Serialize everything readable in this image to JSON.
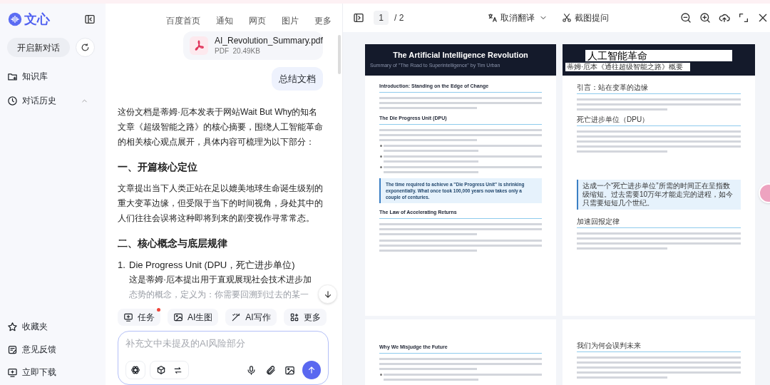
{
  "sidebar": {
    "logo": "文心",
    "new_chat": "开启新对话",
    "nav": [
      {
        "label": "知识库"
      },
      {
        "label": "对话历史",
        "expanded": true
      }
    ],
    "bottom": [
      {
        "label": "收藏夹"
      },
      {
        "label": "意见反馈"
      },
      {
        "label": "立即下载"
      }
    ]
  },
  "top_links": [
    "百度首页",
    "通知",
    "网页",
    "图片",
    "更多"
  ],
  "chat": {
    "attachment": {
      "name": "AI_Revolution_Summary.pdf",
      "meta": "PDF  20.49KB"
    },
    "user_message": "总结文档",
    "answer": [
      {
        "kind": "paragraph",
        "text": "这份文档是蒂姆·厄本发表于网站Wait But Why的知名文章《超级智能之路》的核心摘要，围绕人工智能革命的相关核心观点展开，具体内容可梳理为以下部分："
      },
      {
        "kind": "heading",
        "text": "一、开篇核心定位"
      },
      {
        "kind": "paragraph",
        "text": "文章提出当下人类正站在足以媲美地球生命诞生级别的重大变革边缘，但受限于当下的时间视角，身处其中的人们往往会误将这种即将到来的剧变视作寻常常态。"
      },
      {
        "kind": "heading",
        "text": "二、核心概念与底层规律"
      },
      {
        "kind": "list_item",
        "number": "1.",
        "title": "Die Progress Unit (DPU，死亡进步单位)",
        "text": "这是蒂姆·厄本提出用于直观展现社会技术进步加",
        "faded_text": "态势的概念，定义为：你需要回溯到过去的某一"
      }
    ],
    "tools": [
      {
        "label": "任务",
        "badge": true
      },
      {
        "label": "AI生图",
        "badge": false
      },
      {
        "label": "AI写作",
        "badge": false
      },
      {
        "label": "更多",
        "badge": false
      }
    ],
    "composer": {
      "placeholder": "补充文中未提及的AI风险部分"
    }
  },
  "viewer": {
    "page": "1",
    "total": "/ 2",
    "translate": "取消翻译",
    "screenshot": "截图提问",
    "rows": [
      {
        "original": {
          "title": "The Artificial Intelligence Revolution",
          "subtitle": "Summary of \"The Road to Superintelligence\" by Tim Urban",
          "sections": [
            {
              "heading": "Introduction: Standing on the Edge of Change",
              "blocks": [
                {
                  "kind": "paragraph"
                }
              ]
            },
            {
              "heading": "The Die Progress Unit (DPU)",
              "blocks": [
                {
                  "kind": "paragraph"
                },
                {
                  "kind": "bullet"
                },
                {
                  "kind": "bullet"
                },
                {
                  "kind": "bullet"
                },
                {
                  "kind": "quote",
                  "text": "The time required to achieve a \"Die Progress Unit\" is shrinking exponentially. What once took 100,000 years now takes only a couple of centuries."
                }
              ]
            },
            {
              "heading": "The Law of Accelerating Returns",
              "blocks": [
                {
                  "kind": "paragraph"
                },
                {
                  "kind": "paragraph"
                }
              ]
            }
          ]
        },
        "translated": {
          "title": "人工智能革命",
          "subtitle": "蒂姆·厄本《通往超级智能之路》概要",
          "sections": [
            {
              "heading": "引言：站在变革的边缘"
            },
            {
              "heading": "死亡进步单位（DPU）",
              "quote": "达成一个“死亡进步单位”所需的时间正在呈指数级缩短。过去需要10万年才能走完的进程，如今只需要短短几个世纪。"
            },
            {
              "heading": "加速回报定律"
            }
          ]
        }
      },
      {
        "original": {
          "sections": [
            {
              "heading": "Why We Misjudge the Future",
              "blocks": [
                {
                  "kind": "paragraph"
                },
                {
                  "kind": "bullet"
                }
              ]
            }
          ]
        },
        "translated": {
          "sections": [
            {
              "heading": "我们为何会误判未来"
            }
          ]
        }
      }
    ]
  }
}
